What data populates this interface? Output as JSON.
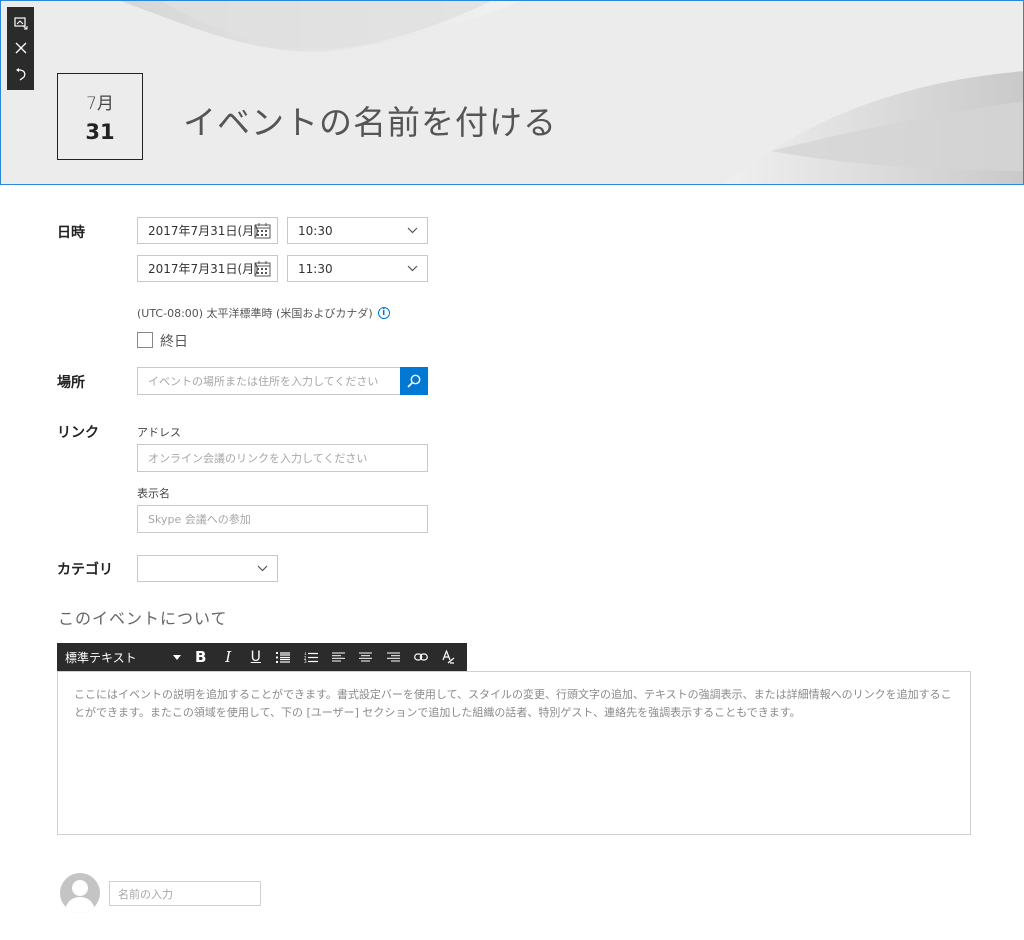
{
  "header": {
    "date_month": "7月",
    "date_day": "31",
    "title": "イベントの名前を付ける"
  },
  "edit_toolbar": {
    "icons": [
      "replace-image-icon",
      "close-icon",
      "undo-icon"
    ]
  },
  "datetime": {
    "label": "日時",
    "start_date": "2017年7月31日(月)",
    "start_time": "10:30",
    "end_date": "2017年7月31日(月)",
    "end_time": "11:30",
    "timezone": "(UTC-08:00) 太平洋標準時 (米国およびカナダ)",
    "all_day_label": "終日"
  },
  "location": {
    "label": "場所",
    "placeholder": "イベントの場所または住所を入力してください"
  },
  "link": {
    "label": "リンク",
    "address_label": "アドレス",
    "address_placeholder": "オンライン会議のリンクを入力してください",
    "display_label": "表示名",
    "display_placeholder": "Skype 会議への参加"
  },
  "category": {
    "label": "カテゴリ",
    "value": ""
  },
  "about": {
    "title": "このイベントについて",
    "style_select": "標準テキスト",
    "toolbar_buttons": [
      "bold-icon",
      "italic-icon",
      "underline-icon",
      "bullet-list-icon",
      "numbered-list-icon",
      "align-left-icon",
      "align-center-icon",
      "align-right-icon",
      "link-icon",
      "clear-format-icon"
    ],
    "body_placeholder": "ここにはイベントの説明を追加することができます。書式設定バーを使用して、スタイルの変更、行頭文字の追加、テキストの強調表示、または詳細情報へのリンクを追加することができます。またこの領域を使用して、下の [ユーザー] セクションで追加した組織の話者、特別ゲスト、連絡先を強調表示することもできます。"
  },
  "author": {
    "name_placeholder": "名前の入力"
  },
  "colors": {
    "accent": "#0078d4",
    "toolbar_bg": "#2b2b2b",
    "banner_bg": "#ececec"
  }
}
